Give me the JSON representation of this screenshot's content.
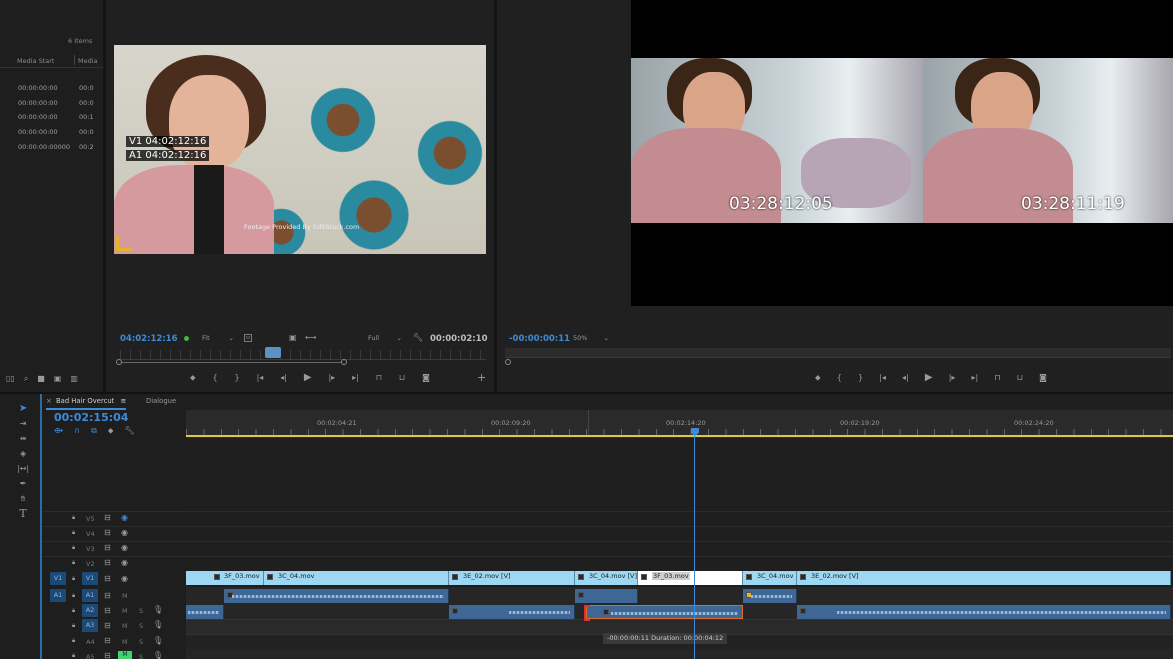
{
  "project": {
    "items_count": "6 Items",
    "col_media_start": "Media Start",
    "col_media": "Media",
    "rows": [
      {
        "start": "00:00:00:00",
        "next": "00:0"
      },
      {
        "start": "00:00:00:00",
        "next": "00:0"
      },
      {
        "start": "00:00:00:00",
        "next": "00:1"
      },
      {
        "start": "00:00:00:00",
        "next": "00:0"
      },
      {
        "start": "00:00:00:00000",
        "next": "00:2"
      }
    ]
  },
  "source": {
    "overlay_v1": "V1 04:02:12:16",
    "overlay_a1": "A1 04:02:12:16",
    "watermark": "Footage Provided By EditStock.com",
    "timecode": "04:02:12:16",
    "fit": "Fit",
    "quality": "Full",
    "duration": "00:00:02:10"
  },
  "program": {
    "left_tc": "03:28:12:05",
    "right_tc": "03:28:11:19",
    "timecode": "-00:00:00:11",
    "zoom": "50%"
  },
  "timeline": {
    "tab_name": "Bad Hair Overcut",
    "tab_menu": "≡",
    "tab_dialogue": "Dialogue",
    "timecode": "00:02:15:04",
    "ruler": [
      "00:02:04:21",
      "00:02:09:20",
      "00:02:14:20",
      "00:02:19:20",
      "00:02:24:20"
    ],
    "video_tracks": [
      "V5",
      "V4",
      "V3",
      "V2",
      "V1"
    ],
    "audio_tracks": [
      "A1",
      "A2",
      "A3",
      "A4",
      "A5"
    ],
    "v_clips": [
      {
        "name": "3F_03.mov"
      },
      {
        "name": "3C_04.mov"
      },
      {
        "name": "3E_02.mov [V]"
      },
      {
        "name": "3C_04.mov [V]"
      },
      {
        "name": "3F_03.mov"
      },
      {
        "name": "3C_04.mov"
      },
      {
        "name": "3E_02.mov [V]"
      }
    ],
    "tooltip": "-00:00:00:11 Duration: 00:00:04:12",
    "src_v1": "V1",
    "src_a1": "A1",
    "m_label": "M",
    "s_label": "S"
  },
  "colors": {
    "accent_blue": "#3d8bd8",
    "clip_video": "#9ed7f2",
    "clip_audio": "#3f6795",
    "ruler_line": "#e1c44a"
  }
}
